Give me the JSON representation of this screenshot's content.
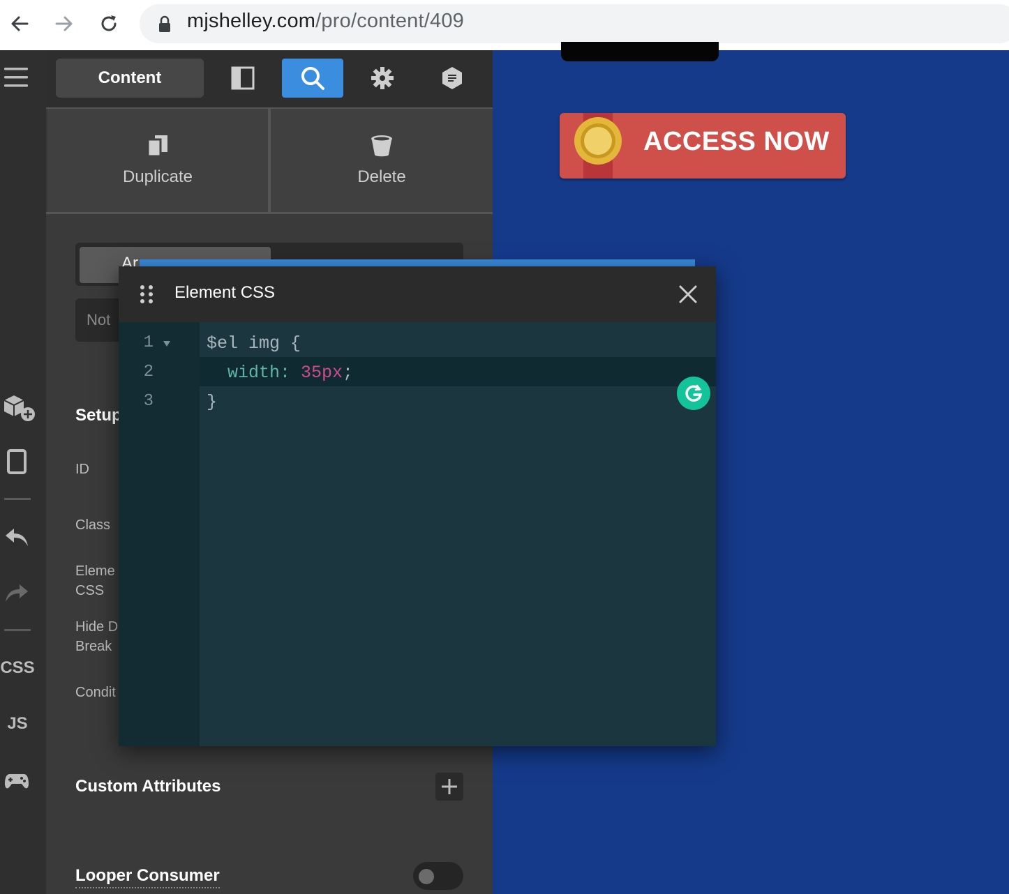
{
  "browser": {
    "url_domain": "mjshelley.com",
    "url_path": "/pro/content/409"
  },
  "panel": {
    "tabs": {
      "content_label": "Content"
    },
    "actions": {
      "duplicate_label": "Duplicate",
      "delete_label": "Delete"
    },
    "partial": {
      "segment_left": "Ar",
      "select_value": "Not",
      "setup_heading": "Setup",
      "id_label": "ID",
      "class_label": "Class",
      "element_css_label_1": "Eleme",
      "element_css_label_2": "CSS",
      "hide_label_1": "Hide D",
      "hide_label_2": "Break",
      "conditions_label": "Condit"
    },
    "custom_attributes_heading": "Custom Attributes",
    "looper_consumer_heading": "Looper Consumer"
  },
  "rail": {
    "css_label": "CSS",
    "js_label": "JS"
  },
  "canvas": {
    "access_button_label": "ACCESS NOW"
  },
  "modal": {
    "title": "Element CSS",
    "line_numbers": [
      "1",
      "2",
      "3"
    ],
    "code_line1": "$el img {",
    "code_line2_prop": "width:",
    "code_line2_value": "35px",
    "code_line2_semicolon": ";",
    "code_line3": "}"
  },
  "colors": {
    "accent_blue": "#3b8de0",
    "canvas_blue": "#153a8a",
    "button_red": "#cf4f4b",
    "code_property": "#5fb3a8",
    "code_value": "#d04a8c"
  }
}
